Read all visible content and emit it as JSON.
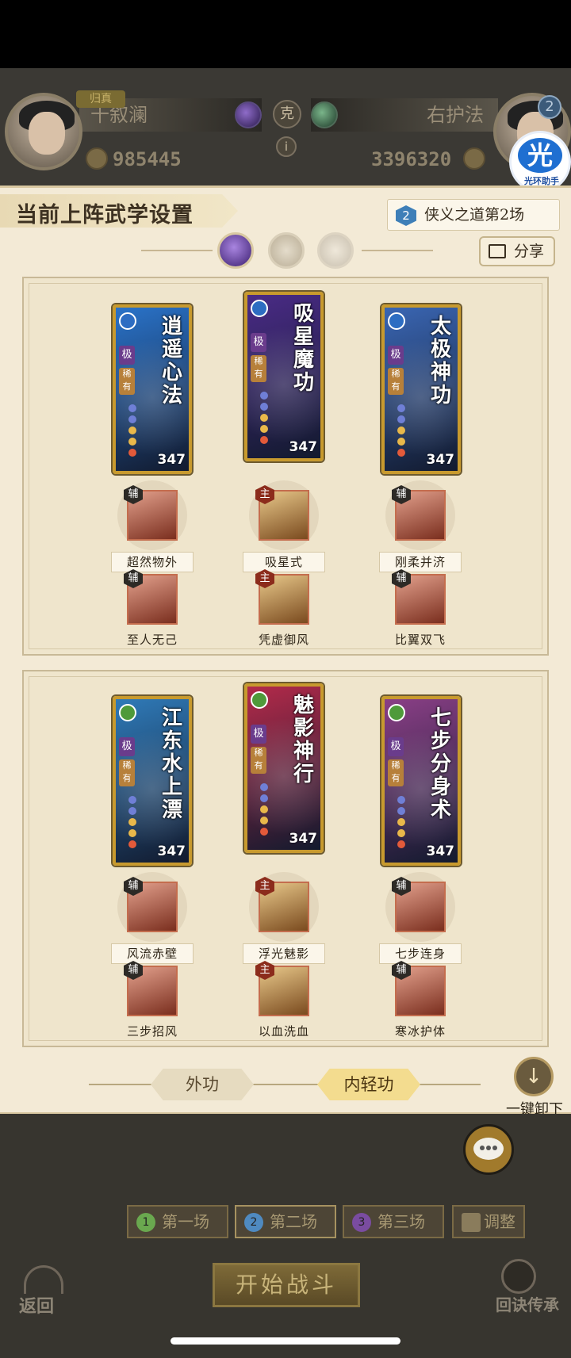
{
  "header": {
    "left_player": {
      "title_tag": "归真",
      "name": "十叙澜",
      "gold": "985445"
    },
    "right_player": {
      "name": "右护法",
      "gold": "3396320",
      "level": "2"
    },
    "vs_char": "克",
    "info_icon": "i",
    "assistant": {
      "glyph": "光",
      "label": "光环助手"
    }
  },
  "panel": {
    "section_title": "当前上阵武学设置",
    "round_label": "侠义之道第2场",
    "round_num": "2",
    "share_label": "分享"
  },
  "group1": {
    "cards": [
      {
        "title": "逍遥心法",
        "power": "347",
        "color": "#2a73c9"
      },
      {
        "title": "吸星魔功",
        "power": "347",
        "color": "#4a2b86"
      },
      {
        "title": "太极神功",
        "power": "347",
        "color": "#3a66b3"
      }
    ],
    "skills_row1": [
      {
        "tag": "辅",
        "name": "超然物外"
      },
      {
        "tag": "主",
        "name": "吸星式"
      },
      {
        "tag": "辅",
        "name": "刚柔并济"
      }
    ],
    "skills_row2": [
      {
        "tag": "辅",
        "name": "至人无己"
      },
      {
        "tag": "主",
        "name": "凭虚御风"
      },
      {
        "tag": "辅",
        "name": "比翼双飞"
      }
    ]
  },
  "group2": {
    "cards": [
      {
        "title": "江东水上漂",
        "power": "347",
        "color": "#2f7ab8"
      },
      {
        "title": "魅影神行",
        "power": "347",
        "color": "#b32a4a"
      },
      {
        "title": "七步分身术",
        "power": "347",
        "color": "#8a3f86"
      }
    ],
    "skills_row1": [
      {
        "tag": "辅",
        "name": "风流赤壁"
      },
      {
        "tag": "主",
        "name": "浮光魅影"
      },
      {
        "tag": "辅",
        "name": "七步连身"
      }
    ],
    "skills_row2": [
      {
        "tag": "辅",
        "name": "三步招风"
      },
      {
        "tag": "主",
        "name": "以血洗血"
      },
      {
        "tag": "辅",
        "name": "寒冰护体"
      }
    ]
  },
  "card_badges": {
    "ji": "极",
    "xi": "稀有"
  },
  "tabs": {
    "outer": "外功",
    "inner": "内轻功"
  },
  "unload": {
    "icon": "↓",
    "label": "一键卸下"
  },
  "bottom": {
    "fights": [
      {
        "num": "1",
        "label": "第一场"
      },
      {
        "num": "2",
        "label": "第二场"
      },
      {
        "num": "3",
        "label": "第三场"
      }
    ],
    "adjust_label": "调整",
    "start_label": "开始战斗",
    "back_label": "返回",
    "recall_label": "回诀传承"
  }
}
